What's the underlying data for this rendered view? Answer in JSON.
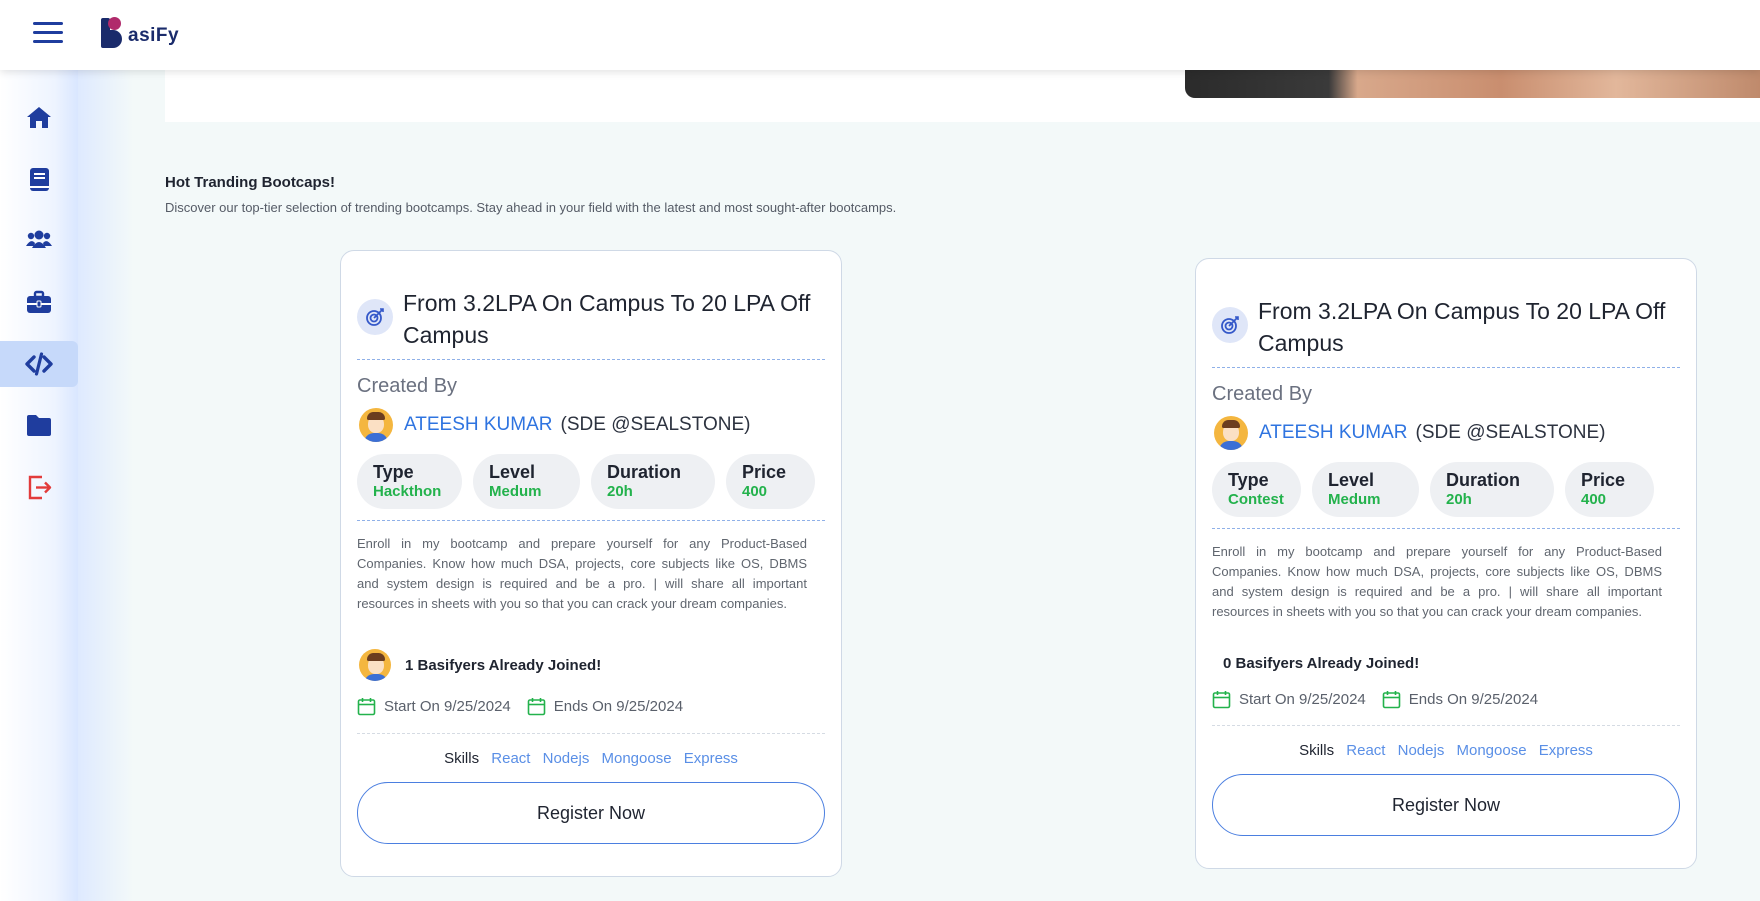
{
  "header": {
    "logo_text": "asiFy"
  },
  "sidebar": {
    "items": [
      {
        "name": "home",
        "icon": "home-icon"
      },
      {
        "name": "courses",
        "icon": "book-icon"
      },
      {
        "name": "community",
        "icon": "users-icon"
      },
      {
        "name": "jobs",
        "icon": "briefcase-icon"
      },
      {
        "name": "bootcamps",
        "icon": "code-icon",
        "active": true
      },
      {
        "name": "projects",
        "icon": "folder-icon"
      },
      {
        "name": "logout",
        "icon": "logout-icon"
      }
    ]
  },
  "section": {
    "title": "Hot Tranding Bootcaps!",
    "subtitle": "Discover our top-tier selection of trending bootcamps. Stay ahead in your field with the latest and most sought-after bootcamps."
  },
  "cards": [
    {
      "title": "From 3.2LPA On Campus To 20 LPA Off Campus",
      "created_by_label": "Created By",
      "author_name": "ATEESH KUMAR",
      "author_role": "(SDE @SEALSTONE)",
      "type_label": "Type",
      "type_value": "Hackthon",
      "level_label": "Level",
      "level_value": "Medum",
      "duration_label": "Duration",
      "duration_value": "20h",
      "price_label": "Price",
      "price_value": "400",
      "description": "Enroll in my bootcamp and prepare yourself for any Product-Based Companies. Know how much DSA, projects, core subjects like OS, DBMS and system design is required and be a pro. | will share all important resources in sheets with you so that you can crack your dream companies.",
      "joined_text": "1 Basifyers Already Joined!",
      "start_text": "Start On 9/25/2024",
      "end_text": "Ends On 9/25/2024",
      "skills_label": "Skills",
      "skills": [
        "React",
        "Nodejs",
        "Mongoose",
        "Express"
      ],
      "register_label": "Register Now"
    },
    {
      "title": "From 3.2LPA On Campus To 20 LPA Off Campus",
      "created_by_label": "Created By",
      "author_name": "ATEESH KUMAR",
      "author_role": "(SDE @SEALSTONE)",
      "type_label": "Type",
      "type_value": "Contest",
      "level_label": "Level",
      "level_value": "Medum",
      "duration_label": "Duration",
      "duration_value": "20h",
      "price_label": "Price",
      "price_value": "400",
      "description": "Enroll in my bootcamp and prepare yourself for any Product-Based Companies. Know how much DSA, projects, core subjects like OS, DBMS and system design is required and be a pro. | will share all important resources in sheets with you so that you can crack your dream companies.",
      "joined_text": "0 Basifyers Already Joined!",
      "start_text": "Start On 9/25/2024",
      "end_text": "Ends On 9/25/2024",
      "skills_label": "Skills",
      "skills": [
        "React",
        "Nodejs",
        "Mongoose",
        "Express"
      ],
      "register_label": "Register Now"
    }
  ],
  "colors": {
    "accent": "#1f3d9e",
    "link": "#2f74e0",
    "success": "#23b24c",
    "danger": "#e23b3b"
  }
}
